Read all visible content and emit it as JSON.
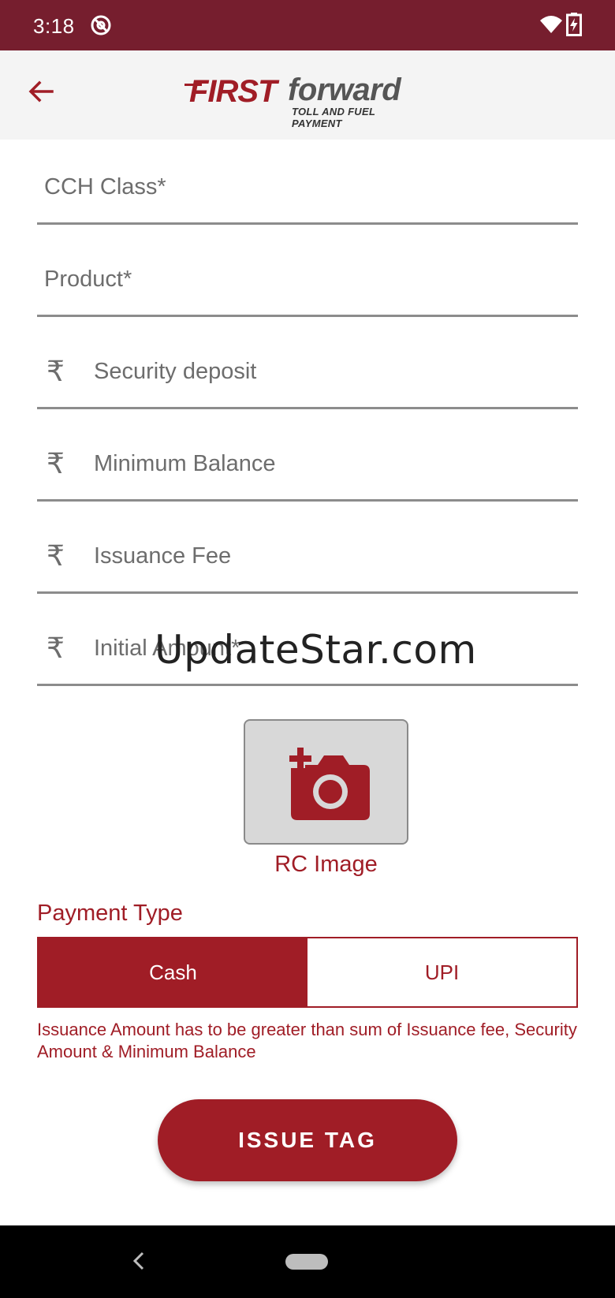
{
  "status_bar": {
    "time": "3:18",
    "icons": [
      "at-sign-icon",
      "wifi-icon",
      "battery-charging-icon"
    ]
  },
  "app_bar": {
    "back_icon": "arrow-left-icon",
    "logo": {
      "first": "FIRST",
      "forward": "forward",
      "tagline": "TOLL AND FUEL PAYMENT"
    }
  },
  "form": {
    "fields": [
      {
        "label": "CCH Class*",
        "currency": ""
      },
      {
        "label": "Product*",
        "currency": ""
      },
      {
        "label": "Security deposit",
        "currency": "₹"
      },
      {
        "label": "Minimum Balance",
        "currency": "₹"
      },
      {
        "label": "Issuance Fee",
        "currency": "₹"
      },
      {
        "label": "Initial Amount*",
        "currency": "₹"
      }
    ]
  },
  "watermark": "UpdateStar.com",
  "rc_image": {
    "icon": "add-photo-camera-icon",
    "label": "RC Image"
  },
  "payment": {
    "title": "Payment Type",
    "options": [
      "Cash",
      "UPI"
    ],
    "selected": "Cash"
  },
  "error_message": "Issuance Amount has to be greater than sum of Issuance fee, Security Amount & Minimum Balance",
  "issue_button": "ISSUE TAG",
  "colors": {
    "brand_red": "#a01d26",
    "status_bar": "#761e2e",
    "app_bar": "#f4f4f4"
  }
}
